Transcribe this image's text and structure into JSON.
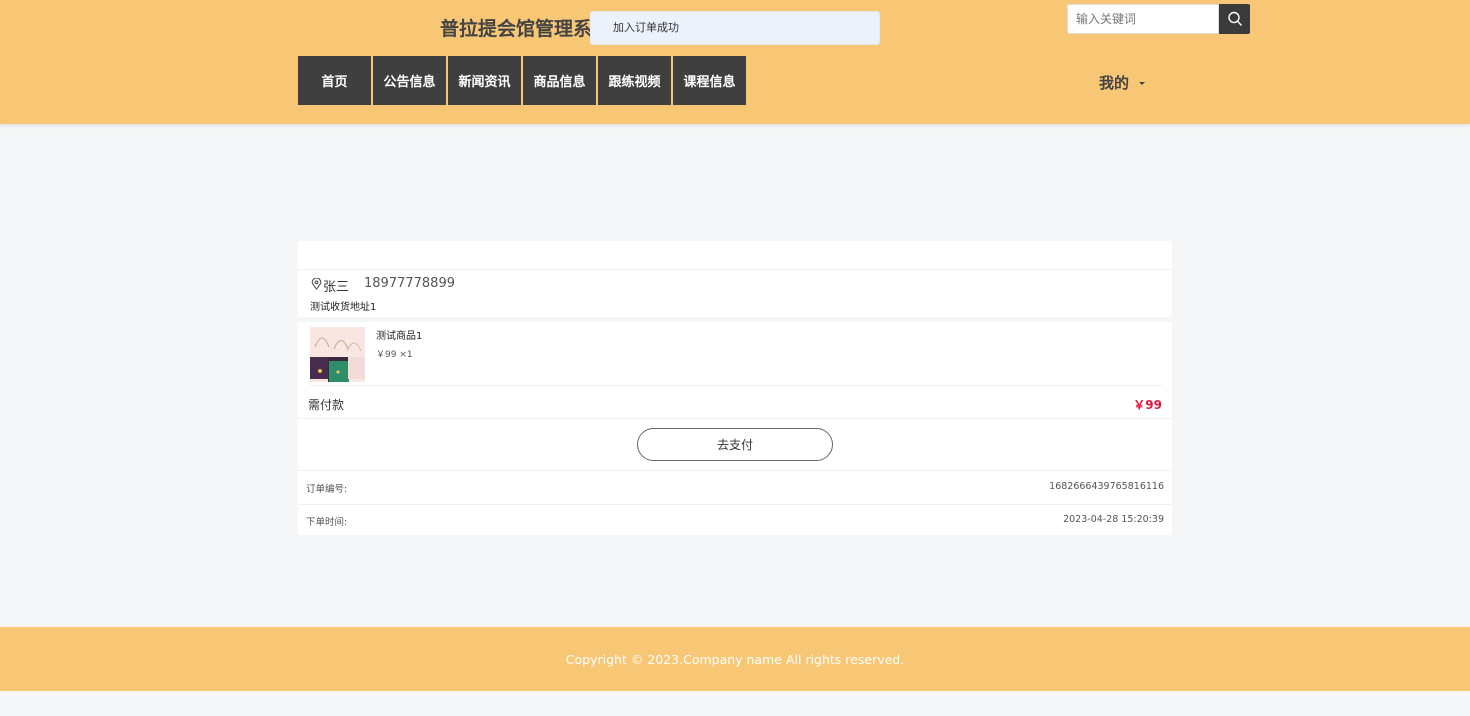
{
  "header": {
    "site_title": "普拉提会馆管理系",
    "toast": "加入订单成功",
    "search_placeholder": "输入关键词",
    "nav": [
      "首页",
      "公告信息",
      "新闻资讯",
      "商品信息",
      "跟练视频",
      "课程信息"
    ],
    "mine": "我的"
  },
  "order": {
    "name": "张三",
    "phone": "18977778899",
    "address": "测试收货地址1",
    "product_name": "测试商品1",
    "product_price": "￥99 ×1",
    "due_label": "需付款",
    "due_value": "￥99",
    "pay_button": "去支付",
    "order_no_label": "订单编号:",
    "order_no": "1682666439765816116",
    "time_label": "下单时间:",
    "time": "2023-04-28 15:20:39"
  },
  "footer": {
    "copyright": "Copyright © 2023.Company name All rights reserved."
  },
  "colors": {
    "header_bg": "#f8c775",
    "nav_bg": "#3f3f3f",
    "price_red": "#e3173d",
    "toast_bg": "#ecf2fb"
  },
  "icons": [
    "search-icon",
    "location-icon",
    "chevron-down-icon"
  ]
}
